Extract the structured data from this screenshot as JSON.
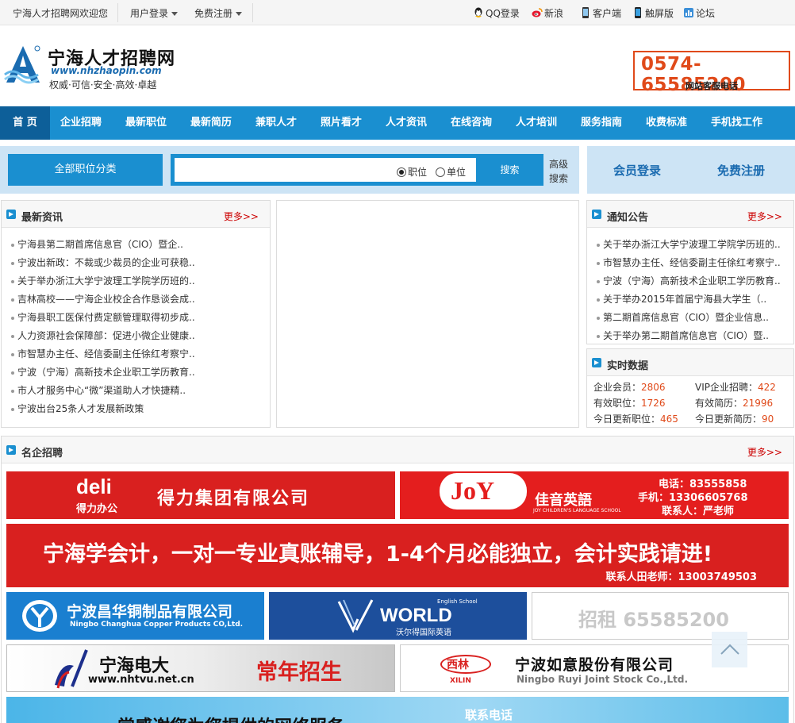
{
  "topbar": {
    "welcome": "宁海人才招聘网欢迎您",
    "login": "用户登录",
    "register": "免费注册",
    "links": [
      {
        "label": "QQ登录",
        "icon": "qq-icon"
      },
      {
        "label": "新浪",
        "icon": "weibo-icon"
      },
      {
        "label": "客户端",
        "icon": "phone-icon"
      },
      {
        "label": "触屏版",
        "icon": "mobile-icon"
      },
      {
        "label": "论坛",
        "icon": "forum-icon"
      }
    ]
  },
  "header": {
    "site_name": "宁海人才招聘网",
    "url": "www.nhzhaopin.com",
    "slogan": "权威·可信·安全·高效·卓越",
    "hotline": "0574-65585200",
    "hotline_caption": "网站客服电话"
  },
  "nav": [
    "首 页",
    "企业招聘",
    "最新职位",
    "最新简历",
    "兼职人才",
    "照片看才",
    "人才资讯",
    "在线咨询",
    "人才培训",
    "服务指南",
    "收费标准",
    "手机找工作"
  ],
  "search": {
    "all_categories": "全部职位分类",
    "placeholder": "",
    "radio_job": "职位",
    "radio_company": "单位",
    "button": "搜索",
    "advanced": "高级搜索"
  },
  "member": {
    "login": "会员登录",
    "register": "免费注册"
  },
  "news": {
    "title": "最新资讯",
    "more": "更多>>",
    "items": [
      "宁海县第二期首席信息官（CIO）暨企..",
      "宁波出新政：不裁或少裁员的企业可获稳..",
      "关于举办浙江大学宁波理工学院学历班的..",
      "吉林高校——宁海企业校企合作恳谈会成..",
      "宁海县职工医保付费定额管理取得初步成..",
      "人力资源社会保障部：促进小微企业健康..",
      "市智慧办主任、经信委副主任徐红考察宁..",
      "宁波（宁海）高新技术企业职工学历教育..",
      "市人才服务中心“微”渠道助人才快捷精..",
      "宁波出台25条人才发展新政策"
    ]
  },
  "notice": {
    "title": "通知公告",
    "more": "更多>>",
    "items": [
      "关于举办浙江大学宁波理工学院学历班的..",
      "市智慧办主任、经信委副主任徐红考察宁..",
      "宁波（宁海）高新技术企业职工学历教育..",
      "关于举办2015年首届宁海县大学生（..",
      "第二期首席信息官（CIO）暨企业信息..",
      "关于举办第二期首席信息官（CIO）暨.."
    ]
  },
  "realtime": {
    "title": "实时数据",
    "stats": [
      {
        "label": "企业会员：",
        "value": "2806"
      },
      {
        "label": "VIP企业招聘：",
        "value": "422"
      },
      {
        "label": "有效职位：",
        "value": "1726"
      },
      {
        "label": "有效简历：",
        "value": "21996"
      },
      {
        "label": "今日更新职位：",
        "value": "465"
      },
      {
        "label": "今日更新简历：",
        "value": "90"
      }
    ]
  },
  "famous": {
    "title": "名企招聘",
    "more": "更多>>"
  },
  "banners": {
    "deli_logo": "deli",
    "deli_sub": "得力办公",
    "deli_name": "得力集团有限公司",
    "joy_name": "佳音英語",
    "joy_sub": "JOY CHILDREN'S LANGUAGE SCHOOL",
    "joy_tel": "电话：83555858",
    "joy_mobile": "手机：13306605768",
    "joy_contact": "联系人：严老师",
    "acct_main": "宁海学会计，一对一专业真账辅导，1-4个月必能独立，会计实践请进!",
    "acct_contact": "联系人田老师：13003749503",
    "ch_name": "宁波昌华铜制品有限公司",
    "ch_en": "Ningbo Changhua Copper Products CO,Ltd.",
    "world_en": "WORLD",
    "world_school": "English School",
    "world_cn": "沃尔得国际英语",
    "rent": "招租 65585200",
    "nhtvu_name": "宁海电大",
    "nhtvu_url": "www.nhtvu.net.cn",
    "nhtvu_slogan": "常年招生",
    "ruyi_logo": "西林",
    "ruyi_logo_en": "XILIN",
    "ruyi_name": "宁波如意股份有限公司",
    "ruyi_en": "Ningbo Ruyi Joint Stock Co.,Ltd.",
    "bottom_text": "常感谢您为您提供的网络服务",
    "bottom_contact": "联系电话"
  },
  "colors": {
    "brand": "#1a8fd0",
    "accent": "#e04a1a",
    "banner_red": "#d9201f"
  }
}
